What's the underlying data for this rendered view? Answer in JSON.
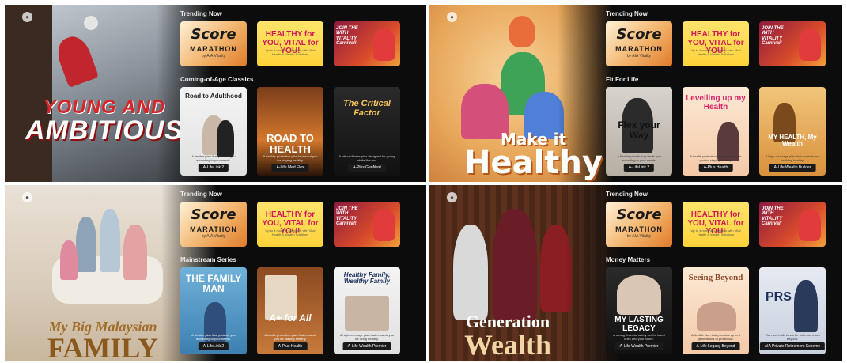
{
  "panels": [
    {
      "hero": {
        "title_line1": "YOUNG AND",
        "title_line2": "AMBITIOUS"
      },
      "trending_label": "Trending Now",
      "row2_label": "Coming-of-Age Classics",
      "trending": [
        {
          "title": "Score",
          "subtitle": "MARATHON",
          "byline": "by AIA Vitality"
        },
        {
          "title": "HEALTHY for YOU, VITAL for YOU!",
          "desc": "Up to 4 months' cashback with Vital Health & Wealth Solutions"
        },
        {
          "title": "JOIN THE WITH VITALITY Carnival!"
        }
      ],
      "row2": [
        {
          "title": "Road to Adulthood",
          "desc": "A flexible plan that protects you according to your needs.",
          "pill": "A-LifeLink 2"
        },
        {
          "title": "ROAD TO HEALTH",
          "desc": "A flexible protection plan to reward you for staying healthy.",
          "pill": "A-Life Med Flex"
        },
        {
          "title": "The Critical Factor",
          "desc": "A critical illness plan designed for young adults like you.",
          "pill": "A-Plus GenNext"
        }
      ]
    },
    {
      "hero": {
        "title_line1": "Make it",
        "title_line2": "Healthy"
      },
      "trending_label": "Trending Now",
      "row2_label": "Fit For Life",
      "trending": [
        {
          "title": "Score",
          "subtitle": "MARATHON",
          "byline": "by AIA Vitality"
        },
        {
          "title": "HEALTHY for YOU, VITAL for YOU!",
          "desc": "Up to 4 months' cashback with Vital Health & Wealth Solutions"
        },
        {
          "title": "JOIN THE WITH VITALITY Carnival!"
        }
      ],
      "row2": [
        {
          "title": "Flex your Way",
          "desc": "A flexible plan that protects you according to your needs.",
          "pill": "A-LifeLink 2"
        },
        {
          "title": "Levelling up my Health",
          "desc": "A health protection plan that rewards you for staying healthy.",
          "pill": "A-Plus Health"
        },
        {
          "title": "MY HEALTH, My Wealth",
          "desc": "A high-coverage plan that rewards you for living healthy.",
          "pill": "A-Life Wealth Builder"
        }
      ]
    },
    {
      "hero": {
        "title_line1": "My Big Malaysian",
        "title_line2": "FAMILY"
      },
      "trending_label": "Trending Now",
      "row2_label": "Mainstream Series",
      "trending": [
        {
          "title": "Score",
          "subtitle": "MARATHON",
          "byline": "by AIA Vitality"
        },
        {
          "title": "HEALTHY for YOU, VITAL for YOU!",
          "desc": "Up to 4 months' cashback with Vital Health & Wealth Solutions"
        },
        {
          "title": "JOIN THE WITH VITALITY Carnival!"
        }
      ],
      "row2": [
        {
          "title": "THE FAMILY MAN",
          "desc": "A flexible plan that protects you according to your needs.",
          "pill": "A-LifeLink 2"
        },
        {
          "title": "A+ for All",
          "desc": "A health protection plan that rewards you for staying healthy.",
          "pill": "A-Plus Health"
        },
        {
          "title": "Healthy Family, Wealthy Family",
          "desc": "A high-coverage plan that rewards you for living healthy.",
          "pill": "A-Life Wealth Premier"
        }
      ]
    },
    {
      "hero": {
        "title_line1": "Generation",
        "title_line2": "Wealth"
      },
      "trending_label": "Trending Now",
      "row2_label": "Money Matters",
      "trending": [
        {
          "title": "Score",
          "subtitle": "MARATHON",
          "byline": "by AIA Vitality"
        },
        {
          "title": "HEALTHY for YOU, VITAL for YOU!",
          "desc": "Up to 4 months' cashback with Vital Health & Wealth Solutions"
        },
        {
          "title": "JOIN THE WITH VITALITY Carnival!"
        }
      ],
      "row2": [
        {
          "title": "MY LASTING LEGACY",
          "desc": "A strong financial safety net for loved ones and your future.",
          "pill": "A-Life Wealth Premier"
        },
        {
          "title": "Seeing Beyond",
          "desc": "A flexible plan that provides up to 3 generations of protection.",
          "pill": "A-Life Legacy Beyond"
        },
        {
          "title": "PRS",
          "desc": "Plan and build funds for retirement and beyond.",
          "pill": "AIA Private Retirement Scheme"
        }
      ]
    }
  ]
}
